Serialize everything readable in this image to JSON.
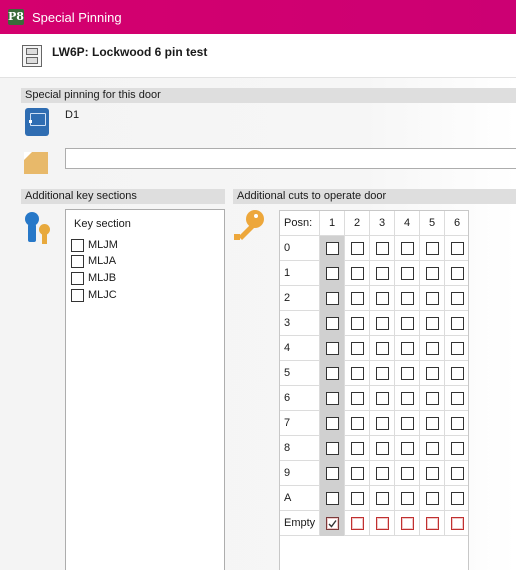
{
  "window": {
    "title": "Special Pinning",
    "app_icon_text": "P8",
    "accent_color": "#d4006e"
  },
  "header": {
    "door_code": "LW6P: Lockwood 6 pin test",
    "icon": "cabinet-icon"
  },
  "special_pinning": {
    "section_label": "Special pinning for this door",
    "door_name": "D1",
    "note_value": ""
  },
  "key_sections": {
    "section_label": "Additional key sections",
    "column_header": "Key section",
    "items": [
      {
        "label": "MLJM",
        "checked": false
      },
      {
        "label": "MLJA",
        "checked": false
      },
      {
        "label": "MLJB",
        "checked": false
      },
      {
        "label": "MLJC",
        "checked": false
      }
    ]
  },
  "cuts": {
    "section_label": "Additional cuts to operate door",
    "position_header": "Posn:",
    "columns": [
      "1",
      "2",
      "3",
      "4",
      "5",
      "6"
    ],
    "rows": [
      "0",
      "1",
      "2",
      "3",
      "4",
      "5",
      "6",
      "7",
      "8",
      "9",
      "A",
      "Empty"
    ],
    "empty_row_checked": [
      true,
      false,
      false,
      false,
      false,
      false
    ]
  }
}
